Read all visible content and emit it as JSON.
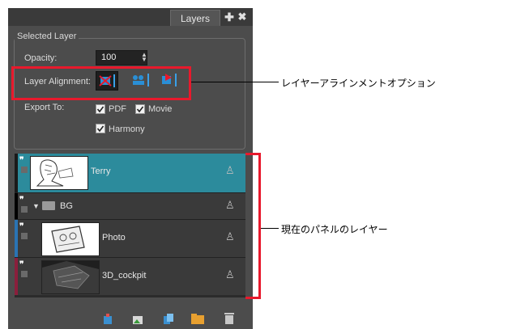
{
  "panel": {
    "tab_label": "Layers",
    "group_title": "Selected Layer",
    "opacity_label": "Opacity:",
    "opacity_value": "100",
    "alignment_label": "Layer Alignment:",
    "export_label": "Export To:",
    "export_options": [
      {
        "label": "PDF",
        "checked": true
      },
      {
        "label": "Movie",
        "checked": true
      },
      {
        "label": "Harmony",
        "checked": true
      }
    ]
  },
  "layers": [
    {
      "name": "Terry",
      "selected": true,
      "color": "#2c8b9c"
    },
    {
      "name": "BG",
      "type": "group",
      "color": "#000000"
    },
    {
      "name": "Photo",
      "color": "#2a74b4"
    },
    {
      "name": "3D_cockpit",
      "color": "#8a1f3c"
    }
  ],
  "callouts": {
    "alignment": "レイヤーアラインメントオプション",
    "layers": "現在のパネルのレイヤー"
  },
  "colors": {
    "highlight_red": "#e8192c",
    "selected_row": "#2c8b9c",
    "panel_bg": "#4c4c4c"
  }
}
